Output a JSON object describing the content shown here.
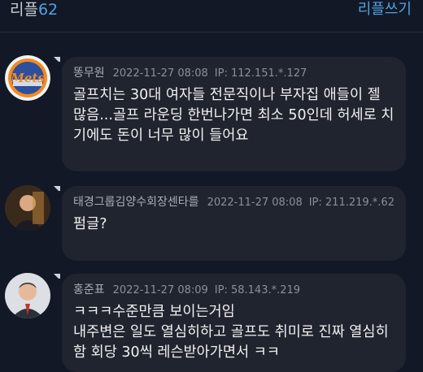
{
  "header": {
    "title": "리플",
    "count": "62",
    "write_label": "리플쓰기"
  },
  "comments": [
    {
      "author": "똥무원",
      "date": "2022-11-27 08:08",
      "ip": "IP: 112.151.*.127",
      "body": "골프치는 30대 여자들 전문직이나 부자집 애들이 젤 많음...골프 라운딩 한번나가면 최소 50인데 허세로 치기에도 돈이 너무 많이 들어요",
      "avatar_icon": "mets-logo-avatar"
    },
    {
      "author": "태경그룹김양수회장센타를",
      "date": "2022-11-27 08:08",
      "ip": "IP: 211.219.*.62",
      "body": "펌글?",
      "avatar_icon": "person-photo-avatar"
    },
    {
      "author": "홍준표",
      "date": "2022-11-27 08:09",
      "ip": "IP: 58.143.*.219",
      "body": "ㅋㅋㅋ수준만큼 보이는거임\n내주변은 일도 열심히하고 골프도 취미로 진짜 열심히함 회당 30씩 레슨받아가면서 ㅋㅋ",
      "avatar_icon": "person-photo-avatar"
    }
  ]
}
